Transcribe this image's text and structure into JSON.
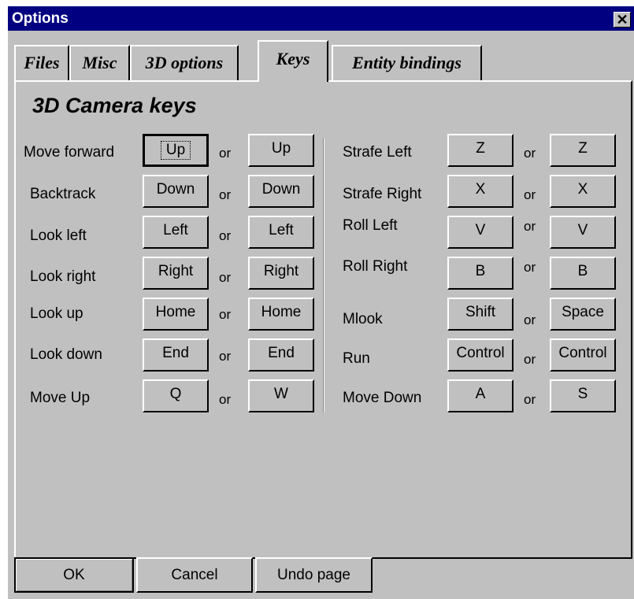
{
  "window": {
    "title": "Options",
    "close_glyph": "✕"
  },
  "tabs": [
    {
      "label": "Files"
    },
    {
      "label": "Misc"
    },
    {
      "label": "3D options"
    },
    {
      "label": "Keys",
      "active": true
    },
    {
      "label": "Entity bindings"
    }
  ],
  "heading": "3D Camera keys",
  "or_label": "or",
  "left_bindings": [
    {
      "label": "Move forward",
      "key1": "Up",
      "key2": "Up"
    },
    {
      "label": "Backtrack",
      "key1": "Down",
      "key2": "Down"
    },
    {
      "label": "Look left",
      "key1": "Left",
      "key2": "Left"
    },
    {
      "label": "Look right",
      "key1": "Right",
      "key2": "Right"
    },
    {
      "label": "Look up",
      "key1": "Home",
      "key2": "Home"
    },
    {
      "label": "Look down",
      "key1": "End",
      "key2": "End"
    },
    {
      "label": "Move Up",
      "key1": "Q",
      "key2": "W"
    }
  ],
  "right_bindings": [
    {
      "label": "Strafe Left",
      "key1": "Z",
      "key2": "Z"
    },
    {
      "label": "Strafe Right",
      "key1": "X",
      "key2": "X"
    },
    {
      "label": "Roll Left",
      "key1": "V",
      "key2": "V"
    },
    {
      "label": "Roll Right",
      "key1": "B",
      "key2": "B"
    },
    {
      "label": "Mlook",
      "key1": "Shift",
      "key2": "Space"
    },
    {
      "label": "Run",
      "key1": "Control",
      "key2": "Control"
    },
    {
      "label": "Move Down",
      "key1": "A",
      "key2": "S"
    }
  ],
  "buttons": {
    "ok": "OK",
    "cancel": "Cancel",
    "undo": "Undo page"
  },
  "colors": {
    "titlebar": "#000080",
    "face": "#c0c0c0"
  }
}
